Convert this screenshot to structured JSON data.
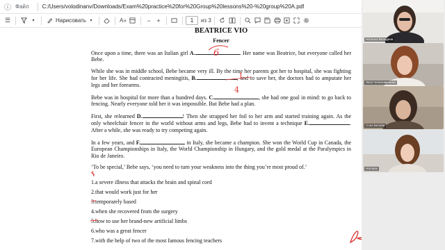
{
  "addressbar": {
    "file_label": "Файл",
    "url": "C:/Users/volodinanv/Downloads/Exam%20practice%20for%20Group%20lessons%20-%20group%20A.pdf"
  },
  "toolbar": {
    "draw_label": "Нарисовать",
    "page_current": "1",
    "page_total": "из 3",
    "zoom_out": "−",
    "zoom_in": "+"
  },
  "document": {
    "title": "BEATRICE VIO",
    "subtitle": "Fencer",
    "p1": {
      "a": "Once upon a time, there was an Italian girl ",
      "label": "A.",
      "b": ". Her name was Beatrice, but everyone called her Bebe."
    },
    "p2": {
      "a": "While she was in middle school, Bebe became very ill. By the time her parents got her to hospital, she was fighting for her life. She had contracted meningitis, ",
      "label": "B.",
      "b": ", and to save her, the doctors had to amputate her legs and her forearms."
    },
    "p3": {
      "a": "Bebe was in hospital for more than a hundred days. ",
      "label": "C.",
      "b": ", she had one goal in mind: to go back to fencing. Nearly everyone told her it was impossible. But Bebe had a plan."
    },
    "p4": {
      "a": "First, she relearned ",
      "label_d": "D.",
      "b": "! Then she strapped her foil to her arm and started training again. As the only wheelchair fencer in the world without arms and legs, Bebe had to invent a technique ",
      "label_e": "E.",
      "c": ". After a while, she was ready to try competing again."
    },
    "p5": {
      "a": "In a few years, and ",
      "label": "F.",
      "b": " in Italy, she became a champion. She won the World Cup in Canada, the European Championships in Italy, the World Championship in Hungary, and the gold medal at the Paralympics in Rio de Janeiro."
    },
    "p6": "‘To be special,’ Bebe says, ‘you need to turn your weakness into the thing you’re most proud of.’",
    "options": [
      "1.a severe illness that attacks the brain and spinal cord",
      "2.that would work just for her",
      "3.temporarely based",
      "4.when she recovered from the surgery",
      "5.how to use her brand-new artificial limbs",
      "6.who was a great fencer",
      "7.with the help of two of the most famous fencing teachers"
    ],
    "handwritten": {
      "a": "6",
      "b": "1",
      "c": "4"
    }
  },
  "participants": [
    {
      "name": "Наталья Володина"
    },
    {
      "name": "Леся Чеченовиченко"
    },
    {
      "name": "Соня Белова"
    },
    {
      "name": "Нагорак"
    }
  ],
  "colors": {
    "ink_red": "#e0302f",
    "pdf_icon_red": "#d9302c"
  }
}
